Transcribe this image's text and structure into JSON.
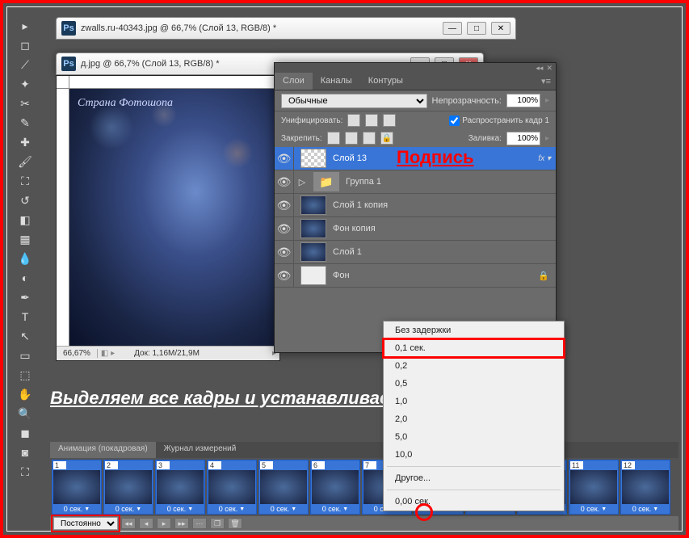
{
  "doc1": {
    "title": "zwalls.ru-40343.jpg @ 66,7% (Слой 13, RGB/8) *"
  },
  "doc2": {
    "title": "д.jpg @ 66,7% (Слой 13, RGB/8) *"
  },
  "photo_sig": "Страна Фотошопа",
  "status": {
    "zoom": "66,67%",
    "doc": "Док: 1,16M/21,9M"
  },
  "layers": {
    "tabs": [
      "Слои",
      "Каналы",
      "Контуры"
    ],
    "blend_label": "Обычные",
    "opacity_label": "Непрозрачность:",
    "opacity_value": "100%",
    "unify_label": "Унифицировать:",
    "propagate_label": "Распространить кадр 1",
    "lock_label": "Закрепить:",
    "fill_label": "Заливка:",
    "fill_value": "100%",
    "items": [
      {
        "name": "Слой 13",
        "selected": true,
        "thumb": "checker",
        "fx": "fx"
      },
      {
        "name": "Группа 1",
        "thumb": "folder",
        "expand": true
      },
      {
        "name": "Слой 1 копия",
        "thumb": "photo"
      },
      {
        "name": "Фон копия",
        "thumb": "photo"
      },
      {
        "name": "Слой 1",
        "thumb": "photo"
      },
      {
        "name": "Фон",
        "thumb": "white",
        "lock": true
      }
    ]
  },
  "sig_anno": "Подпись",
  "delay_menu": {
    "items": [
      "Без задержки",
      "0,1 сек.",
      "0,2",
      "0,5",
      "1,0",
      "2,0",
      "5,0",
      "10,0"
    ],
    "other": "Другое...",
    "current": "0,00 сек."
  },
  "anno_text": "Выделяем все кадры и устанавливаем время.",
  "anim": {
    "tabs": [
      "Анимация (покадровая)",
      "Журнал измерений"
    ],
    "delay_text": "0 сек.",
    "loop": "Постоянно",
    "frame_count": 12
  }
}
